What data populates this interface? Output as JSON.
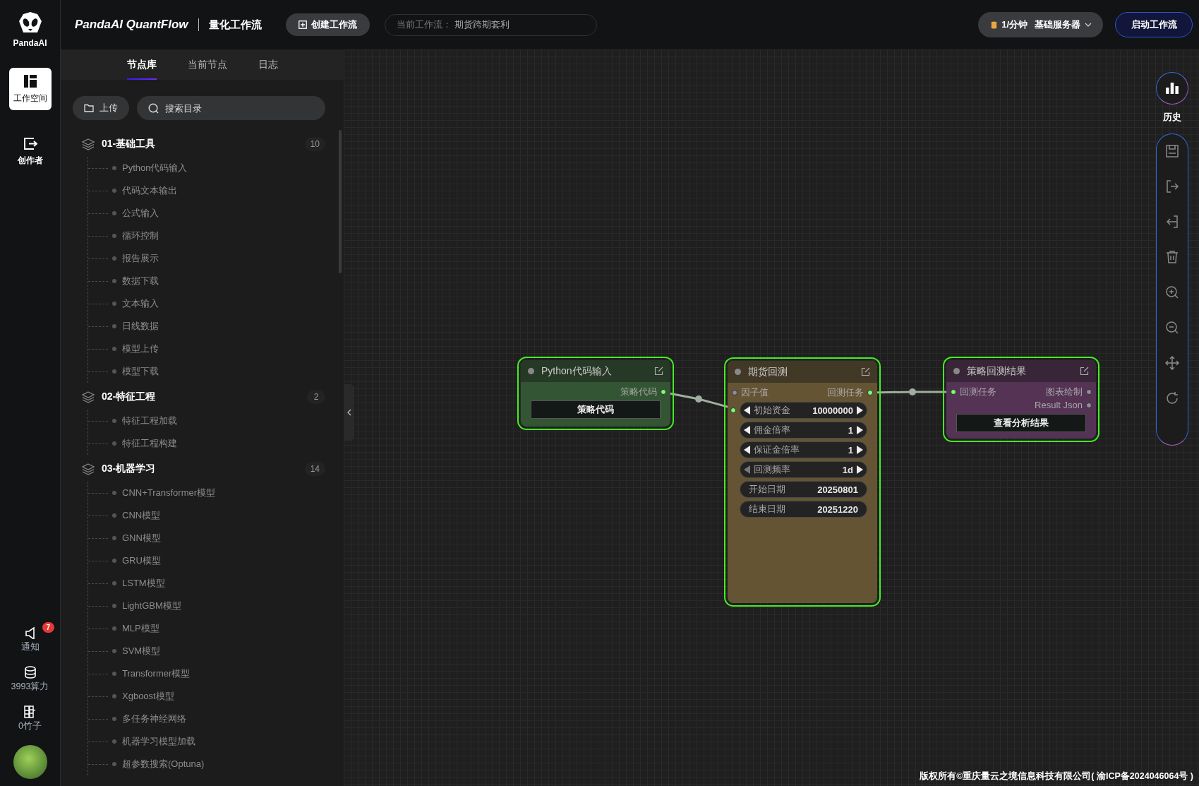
{
  "brand": {
    "name": "PandaAI"
  },
  "rail": {
    "items": [
      {
        "label": "工作空间",
        "selected": true
      },
      {
        "label": "创作者",
        "selected": false
      }
    ],
    "bottom": [
      {
        "label": "通知",
        "badge": "7"
      },
      {
        "label": "3993算力"
      },
      {
        "label": "0竹子"
      }
    ]
  },
  "header": {
    "title": "PandaAI QuantFlow",
    "subtitle": "量化工作流",
    "create_button": "创建工作流",
    "current_workflow": {
      "label": "当前工作流：",
      "value": "期货跨期套利"
    },
    "rate": "1/分钟",
    "server": "基础服务器",
    "start_button": "启动工作流"
  },
  "sidebar": {
    "tabs": [
      {
        "label": "节点库",
        "selected": true
      },
      {
        "label": "当前节点",
        "selected": false
      },
      {
        "label": "日志",
        "selected": false
      }
    ],
    "upload_button": "上传",
    "search": {
      "placeholder": "搜索目录"
    },
    "groups": [
      {
        "title": "01-基础工具",
        "count": "10",
        "children": [
          {
            "label": "Python代码输入"
          },
          {
            "label": "代码文本输出"
          },
          {
            "label": "公式输入"
          },
          {
            "label": "循环控制"
          },
          {
            "label": "报告展示"
          },
          {
            "label": "数据下载"
          },
          {
            "label": "文本输入"
          },
          {
            "label": "日线数据"
          },
          {
            "label": "模型上传"
          },
          {
            "label": "模型下载"
          }
        ]
      },
      {
        "title": "02-特征工程",
        "count": "2",
        "children": [
          {
            "label": "特征工程加载"
          },
          {
            "label": "特征工程构建"
          }
        ]
      },
      {
        "title": "03-机器学习",
        "count": "14",
        "children": [
          {
            "label": "CNN+Transformer模型"
          },
          {
            "label": "CNN模型"
          },
          {
            "label": "GNN模型"
          },
          {
            "label": "GRU模型"
          },
          {
            "label": "LSTM模型"
          },
          {
            "label": "LightGBM模型"
          },
          {
            "label": "MLP模型"
          },
          {
            "label": "SVM模型"
          },
          {
            "label": "Transformer模型"
          },
          {
            "label": "Xgboost模型"
          },
          {
            "label": "多任务神经网络"
          },
          {
            "label": "机器学习模型加载"
          },
          {
            "label": "超参数搜索(Optuna)"
          }
        ]
      }
    ]
  },
  "canvas": {
    "nodes": [
      {
        "title": "Python代码输入",
        "color": "#335533",
        "selected": true,
        "outputs": [
          {
            "label": "策略代码",
            "connected": true
          }
        ],
        "button": "策略代码"
      },
      {
        "title": "期货回测",
        "color": "#655434",
        "selected": true,
        "inputs": [
          {
            "label": "因子值",
            "connected": false
          }
        ],
        "outputs": [
          {
            "label": "回测任务",
            "connected": true
          }
        ],
        "widgets": [
          {
            "kind": "stepper",
            "label": "初始资金",
            "value": "10000000",
            "port_connected": true,
            "prev_disabled": false
          },
          {
            "kind": "stepper",
            "label": "佣金倍率",
            "value": "1",
            "port_connected": false,
            "prev_disabled": false
          },
          {
            "kind": "stepper",
            "label": "保证金倍率",
            "value": "1",
            "port_connected": false,
            "prev_disabled": false
          },
          {
            "kind": "stepper",
            "label": "回测频率",
            "value": "1d",
            "port_connected": false,
            "prev_disabled": true
          },
          {
            "kind": "text",
            "label": "开始日期",
            "value": "20250801"
          },
          {
            "kind": "text",
            "label": "结束日期",
            "value": "20251220"
          }
        ]
      },
      {
        "title": "策略回测结果",
        "color": "#553355",
        "selected": true,
        "inputs": [
          {
            "label": "回测任务",
            "connected": true
          }
        ],
        "outputs": [
          {
            "label": "图表绘制",
            "connected": false
          },
          {
            "label": "Result Json",
            "connected": false
          }
        ],
        "button": "查看分析结果"
      }
    ],
    "history": "历史",
    "footer": "版权所有©重庆量云之境信息科技有限公司( 渝ICP备2024046064号 )"
  }
}
